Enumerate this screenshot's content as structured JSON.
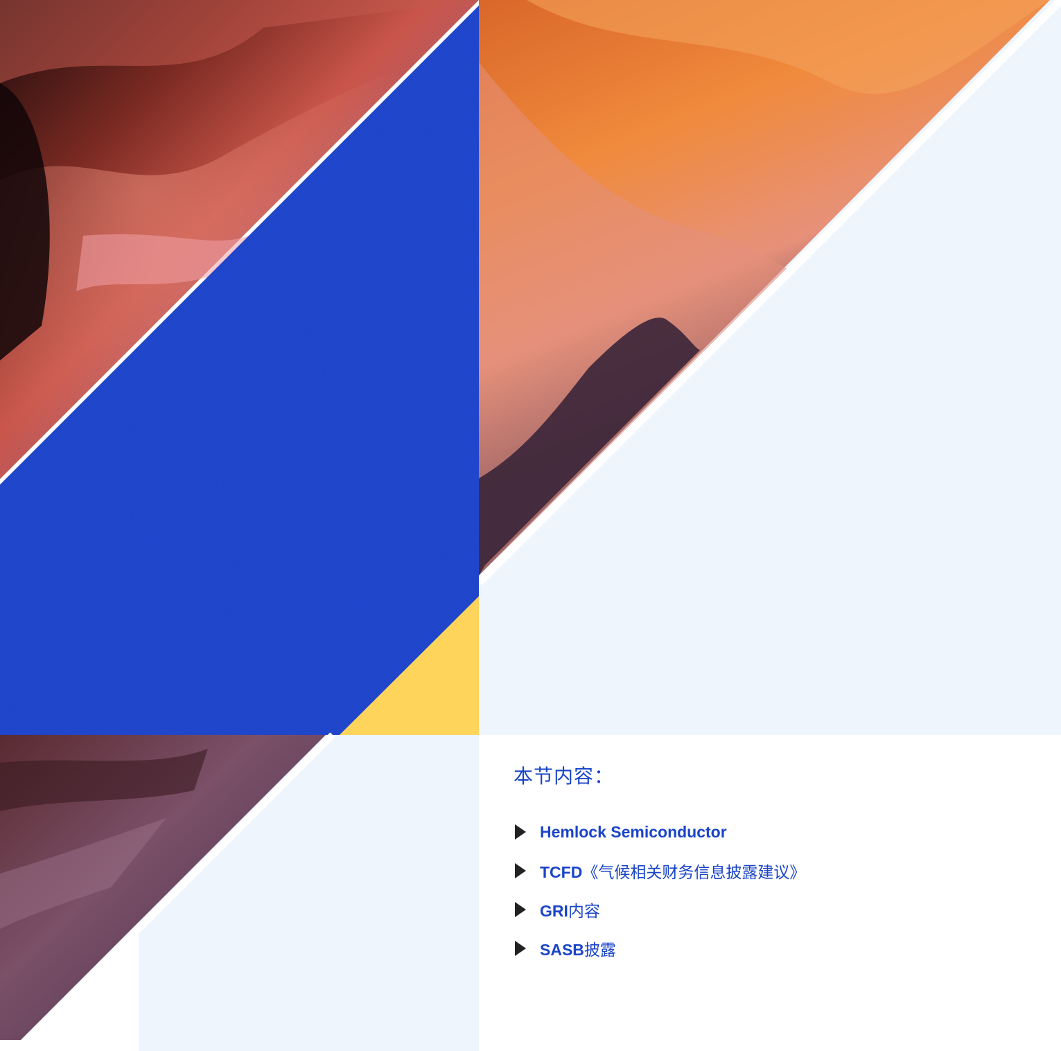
{
  "section": {
    "title": "本节内容：",
    "items": [
      {
        "bold": "Hemlock Semiconductor",
        "rest": ""
      },
      {
        "bold": "TCFD",
        "rest": "《气候相关财务信息披露建议》"
      },
      {
        "bold": "GRI",
        "rest": "内容"
      },
      {
        "bold": "SASB",
        "rest": "披露"
      }
    ]
  },
  "colors": {
    "accent_blue": "#1a3fcc",
    "accent_yellow": "#ffd45a",
    "pale_blue": "#eef5fd",
    "text_blue": "#1a44c8"
  },
  "artwork": {
    "description_icon": "canyon-photo-collage"
  }
}
